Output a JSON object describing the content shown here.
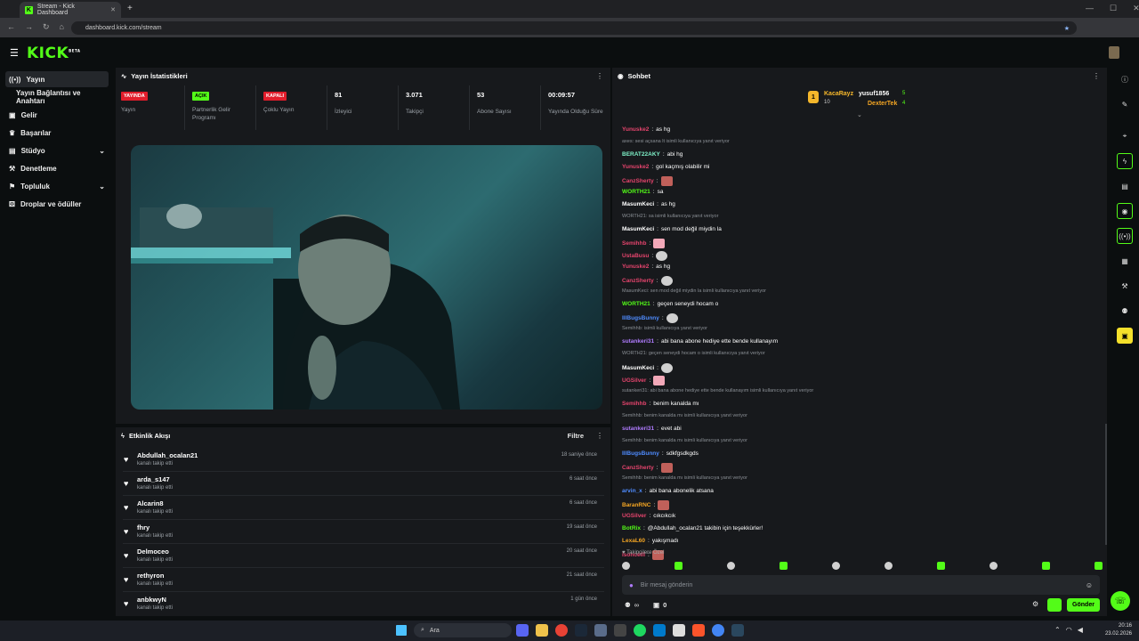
{
  "browser": {
    "tab_title": "Stream - Kick Dashboard",
    "url": "dashboard.kick.com/stream"
  },
  "app": {
    "logo": "KICK",
    "beta": "BETA"
  },
  "sidebar": {
    "items": [
      {
        "label": "Yayın",
        "active": true
      },
      {
        "label": "Yayın Bağlantısı ve Anahtarı"
      },
      {
        "label": "Gelir"
      },
      {
        "label": "Başarılar"
      },
      {
        "label": "Stüdyo",
        "chevron": true
      },
      {
        "label": "Denetleme"
      },
      {
        "label": "Topluluk",
        "chevron": true
      },
      {
        "label": "Droplar ve ödüller"
      }
    ]
  },
  "stats": {
    "title": "Yayın İstatistikleri",
    "cells": [
      {
        "badge": "YAYINDA",
        "badge_color": "red",
        "label": "Yayın"
      },
      {
        "badge": "AÇIK",
        "badge_color": "green",
        "label": "Partnerlik Gelir Programı"
      },
      {
        "badge": "KAPALI",
        "badge_color": "red",
        "label": "Çoklu Yayın"
      },
      {
        "value": "81",
        "label": "İzleyici"
      },
      {
        "value": "3.071",
        "label": "Takipçi"
      },
      {
        "value": "53",
        "label": "Abone Sayısı"
      },
      {
        "value": "00:09:57",
        "label": "Yayında Olduğu Süre"
      }
    ]
  },
  "events": {
    "title": "Etkinlik Akışı",
    "filter": "Filtre",
    "rows": [
      {
        "name": "Abdullah_ocalan21",
        "sub": "kanalı takip etti",
        "time": "18 saniye önce"
      },
      {
        "name": "arda_s147",
        "sub": "kanalı takip etti",
        "time": "6 saat önce"
      },
      {
        "name": "Alcarin8",
        "sub": "kanalı takip etti",
        "time": "6 saat önce"
      },
      {
        "name": "fhry",
        "sub": "kanalı takip etti",
        "time": "19 saat önce"
      },
      {
        "name": "Delmoceo",
        "sub": "kanalı takip etti",
        "time": "20 saat önce"
      },
      {
        "name": "rethyron",
        "sub": "kanalı takip etti",
        "time": "21 saat önce"
      },
      {
        "name": "anbkwyN",
        "sub": "kanalı takip etti",
        "time": "1 gün önce"
      }
    ]
  },
  "chat": {
    "title": "Sohbet",
    "leaderboard": [
      {
        "rank": "1",
        "name": "KacaRayz",
        "count": "10"
      },
      {
        "name": "yusuf1856",
        "count": "5"
      },
      {
        "name": "DexterTek",
        "count": "4"
      }
    ],
    "messages": [
      {
        "user": "Yunuske2",
        "color": "#e5446d",
        "text": "as hg"
      },
      {
        "reply": "axes: sesi açsana lt isimli kullanıcıya yanıt veriyor"
      },
      {
        "user": "BERAT22AKY",
        "color": "#7ff2c9",
        "text": "abi hg"
      },
      {
        "user": "Yunuske2",
        "color": "#e5446d",
        "text": "gol kaçmış olabilir mi"
      },
      {
        "user": "CanzSherty",
        "color": "#e5446d",
        "text": "",
        "emote": "r"
      },
      {
        "user": "WORTH21",
        "color": "#53fc18",
        "text": "sa"
      },
      {
        "user": "MasumKeci",
        "color": "#ffffff",
        "text": "as hg"
      },
      {
        "reply": "WORTH21: sa isimli kullanıcıya yanıt veriyor"
      },
      {
        "user": "MasumKeci",
        "color": "#ffffff",
        "text": "sen mod değil miydin la"
      },
      {
        "user": "Semihhb",
        "color": "#e5446d",
        "text": "",
        "emote": "p"
      },
      {
        "user": "UstaBusu",
        "color": "#e5446d",
        "text": "",
        "emote": "w"
      },
      {
        "user": "Yunuske2",
        "color": "#e5446d",
        "text": "as hg"
      },
      {
        "user": "CanzSherty",
        "color": "#e5446d",
        "text": "",
        "emote": "w"
      },
      {
        "reply": "MasumKeci: sen mod değil miydin la isimli kullanıcıya yanıt veriyor"
      },
      {
        "user": "WORTH21",
        "color": "#53fc18",
        "text": "geçen seneydi hocam o"
      },
      {
        "user": "IllBugsBunny",
        "color": "#4f8cff",
        "text": "",
        "emote": "w"
      },
      {
        "reply": "Semihhb: isimli kullanıcıya yanıt veriyor"
      },
      {
        "user": "sutankeri31",
        "color": "#b07cff",
        "text": "abi bana abone hediye ette bende kullanayım"
      },
      {
        "reply": "WORTH21: geçen seneydi hocam o isimli kullanıcıya yanıt veriyor"
      },
      {
        "user": "MasumKeci",
        "color": "#ffffff",
        "text": "",
        "emote": "w"
      },
      {
        "user": "UGSilver",
        "color": "#e5446d",
        "text": "",
        "emote": "p"
      },
      {
        "reply": "sutankeri31: abi bana abone hediye ette bende kullanayım isimli kullanıcıya yanıt veriyor"
      },
      {
        "user": "Semihhb",
        "color": "#e5446d",
        "text": "benim kanalda mı"
      },
      {
        "reply": "Semihhb: benim kanalda mı isimli kullanıcıya yanıt veriyor"
      },
      {
        "user": "sutankeri31",
        "color": "#b07cff",
        "text": "evet abi"
      },
      {
        "reply": "Semihhb: benim kanalda mı isimli kullanıcıya yanıt veriyor"
      },
      {
        "user": "IllBugsBunny",
        "color": "#4f8cff",
        "text": "sdkfgsdkgds"
      },
      {
        "user": "CanzSherty",
        "color": "#e5446d",
        "text": "",
        "emote": "r"
      },
      {
        "reply": "Semihhb: benim kanalda mı isimli kullanıcıya yanıt veriyor"
      },
      {
        "user": "arvin_x",
        "color": "#4f8cff",
        "text": "abi bana abonelik atsana"
      },
      {
        "user": "BaranRNC",
        "color": "#f5a623",
        "text": "",
        "emote": "r"
      },
      {
        "user": "UGSilver",
        "color": "#e5446d",
        "text": "cıkcıkcık"
      },
      {
        "user": "BotRix",
        "color": "#53fc18",
        "text": "@Abdullah_ocalan21 takibin için teşekkürler!"
      },
      {
        "user": "LexaL60",
        "color": "#f5a623",
        "text": "yakışmadı"
      },
      {
        "user": "isoncelli",
        "color": "#e5446d",
        "text": "",
        "emote": "r"
      }
    ],
    "followers_only": "Takipçilere Özel",
    "input_placeholder": "Bir mesaj gönderin",
    "send": "Gönder",
    "points": "∞",
    "gifts": "0"
  },
  "taskbar": {
    "search": "Ara",
    "time": "20:16",
    "date": "23.02.2026"
  }
}
